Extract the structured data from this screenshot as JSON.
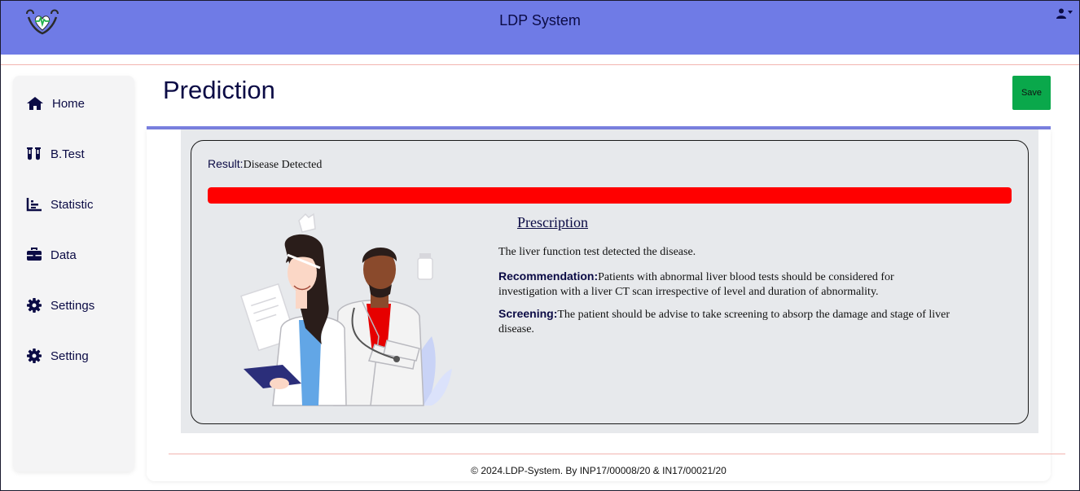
{
  "header": {
    "app_title": "LDP System",
    "icons": [
      "stethoscope-heart-logo",
      "user-icon",
      "caret-down-icon"
    ]
  },
  "sidebar": {
    "items": [
      {
        "label": "Home",
        "icon": "home-icon"
      },
      {
        "label": "B.Test",
        "icon": "test-tubes-icon"
      },
      {
        "label": "Statistic",
        "icon": "chart-icon"
      },
      {
        "label": "Data",
        "icon": "briefcase-icon"
      },
      {
        "label": "Settings",
        "icon": "gear-icon"
      },
      {
        "label": "Setting",
        "icon": "gear-icon"
      }
    ]
  },
  "page": {
    "title": "Prediction",
    "save_label": "Save"
  },
  "result": {
    "label": "Result:",
    "value": "Disease Detected",
    "progress_fraction": 1.0,
    "progress_color": "#ff0000"
  },
  "prescription": {
    "title": "Prescription",
    "intro": "The liver function test detected the disease.",
    "recommendation_label": "Recommendation:",
    "recommendation_text": "Patients with abnormal liver blood tests should be considered for investigation with a liver CT scan irrespective of level and duration of abnormality.",
    "screening_label": "Screening:",
    "screening_text": "The patient should be advise to take screening to absorp the damage and stage of liver disease."
  },
  "footer": {
    "text": "© 2024.LDP-System. By INP17/00008/20 & IN17/00021/20"
  },
  "colors": {
    "header_bg": "#6f7be6",
    "accent_rule": "#7a80e0",
    "save_bg": "#0aa84b",
    "text_navy": "#0b0b45"
  }
}
